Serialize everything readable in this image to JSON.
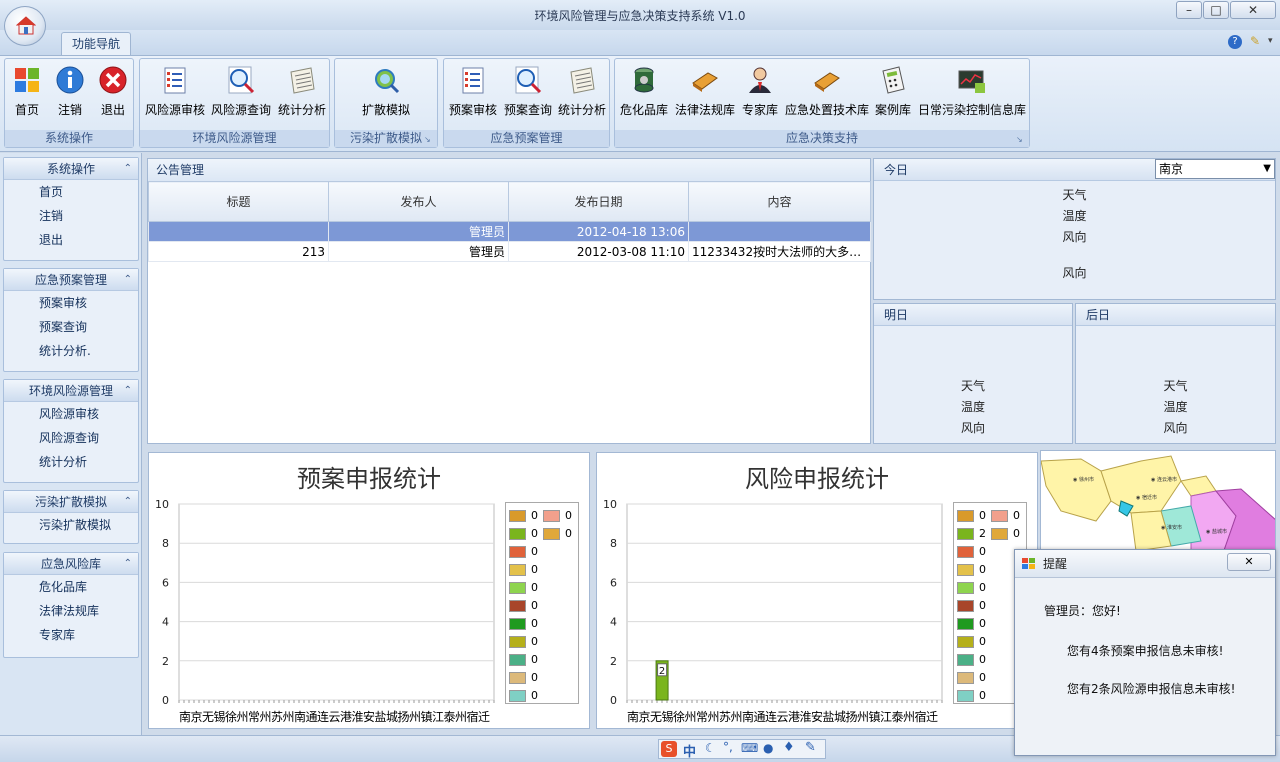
{
  "window": {
    "title": "环境风险管理与应急决策支持系统 V1.0",
    "minimize": "–",
    "maximize": "□",
    "close": "✕"
  },
  "ribbon": {
    "tab": "功能导航",
    "groups": [
      {
        "label": "系统操作",
        "buttons": [
          {
            "label": "首页",
            "icon": "windows-logo-icon"
          },
          {
            "label": "注销",
            "icon": "info-icon"
          },
          {
            "label": "退出",
            "icon": "close-circle-icon"
          }
        ]
      },
      {
        "label": "环境风险源管理",
        "buttons": [
          {
            "label": "风险源审核",
            "icon": "checklist-icon"
          },
          {
            "label": "风险源查询",
            "icon": "magnifier-icon"
          },
          {
            "label": "统计分析",
            "icon": "notepad-icon"
          }
        ]
      },
      {
        "label": "污染扩散模拟",
        "buttons": [
          {
            "label": "扩散模拟",
            "icon": "globe-search-icon"
          }
        ]
      },
      {
        "label": "应急预案管理",
        "buttons": [
          {
            "label": "预案审核",
            "icon": "checklist-icon"
          },
          {
            "label": "预案查询",
            "icon": "magnifier-icon"
          },
          {
            "label": "统计分析",
            "icon": "notepad-icon"
          }
        ]
      },
      {
        "label": "应急决策支持",
        "buttons": [
          {
            "label": "危化品库",
            "icon": "database-icon"
          },
          {
            "label": "法律法规库",
            "icon": "book-icon"
          },
          {
            "label": "专家库",
            "icon": "person-icon"
          },
          {
            "label": "应急处置技术库",
            "icon": "book-icon"
          },
          {
            "label": "案例库",
            "icon": "calculator-icon"
          },
          {
            "label": "日常污染控制信息库",
            "icon": "monitor-chart-icon"
          }
        ]
      }
    ]
  },
  "sidebar": [
    {
      "title": "系统操作",
      "items": [
        "首页",
        "注销",
        "退出"
      ]
    },
    {
      "title": "应急预案管理",
      "items": [
        "预案审核",
        "预案查询",
        "统计分析."
      ]
    },
    {
      "title": "环境风险源管理",
      "items": [
        "风险源审核",
        "风险源查询",
        "统计分析"
      ]
    },
    {
      "title": "污染扩散模拟",
      "items": [
        "污染扩散模拟"
      ]
    },
    {
      "title": "应急风险库",
      "items": [
        "危化品库",
        "法律法规库",
        "专家库"
      ]
    }
  ],
  "announcements": {
    "title": "公告管理",
    "columns": [
      "标题",
      "发布人",
      "发布日期",
      "内容"
    ],
    "rows": [
      {
        "title": "",
        "publisher": "管理员",
        "date": "2012-04-18 13:06",
        "content": "",
        "selected": true
      },
      {
        "title": "213",
        "publisher": "管理员",
        "date": "2012-03-08 11:10",
        "content": "11233432按时大法师的大多是...",
        "selected": false
      }
    ]
  },
  "weather": {
    "city": "南京",
    "today": {
      "title": "今日",
      "weather": "天气",
      "temp": "温度",
      "wind": "风向",
      "wind2": "风向"
    },
    "tomorrow": {
      "title": "明日",
      "weather": "天气",
      "temp": "温度",
      "wind": "风向"
    },
    "after": {
      "title": "后日",
      "weather": "天气",
      "temp": "温度",
      "wind": "风向"
    }
  },
  "chart_data": [
    {
      "type": "bar",
      "title": "预案申报统计",
      "categories": [
        "南京",
        "无锡",
        "徐州",
        "常州",
        "苏州",
        "南通",
        "连云港",
        "淮安",
        "盐城",
        "扬州",
        "镇江",
        "泰州",
        "宿迁"
      ],
      "values": [
        0,
        0,
        0,
        0,
        0,
        0,
        0,
        0,
        0,
        0,
        0,
        0,
        0
      ],
      "ylim": [
        0,
        10
      ],
      "yticks": [
        0,
        2,
        4,
        6,
        8,
        10
      ],
      "xlabel_text": "南京无锡徐州常州苏州南通连云港淮安盐城扬州镇江泰州宿迁",
      "legend_colors": [
        "#d99a2b",
        "#7ab51d",
        "#e0623a",
        "#e3c14a",
        "#8ed44e",
        "#a8452a",
        "#1f9a1f",
        "#b5b01a",
        "#4bb087",
        "#dcb97a",
        "#7fd0c4",
        "#f2a08c",
        "#e0a83a"
      ],
      "grid": true,
      "legend_position": "right"
    },
    {
      "type": "bar",
      "title": "风险申报统计",
      "categories": [
        "南京",
        "无锡",
        "徐州",
        "常州",
        "苏州",
        "南通",
        "连云港",
        "淮安",
        "盐城",
        "扬州",
        "镇江",
        "泰州",
        "宿迁"
      ],
      "values": [
        0,
        2,
        0,
        0,
        0,
        0,
        0,
        0,
        0,
        0,
        0,
        0,
        0
      ],
      "ylim": [
        0,
        10
      ],
      "yticks": [
        0,
        2,
        4,
        6,
        8,
        10
      ],
      "xlabel_text": "南京无锡徐州常州苏州南通连云港淮安盐城扬州镇江泰州宿迁",
      "legend_colors": [
        "#d99a2b",
        "#7ab51d",
        "#e0623a",
        "#e3c14a",
        "#8ed44e",
        "#a8452a",
        "#1f9a1f",
        "#b5b01a",
        "#4bb087",
        "#dcb97a",
        "#7fd0c4",
        "#f2a08c",
        "#e0a83a"
      ],
      "grid": true,
      "legend_position": "right"
    }
  ],
  "popup": {
    "title": "提醒",
    "greeting": "管理员：您好!",
    "line1": "您有4条预案申报信息未审核!",
    "line2": "您有2条风险源申报信息未审核!",
    "close": "✕"
  },
  "ime": {
    "label": "中"
  }
}
